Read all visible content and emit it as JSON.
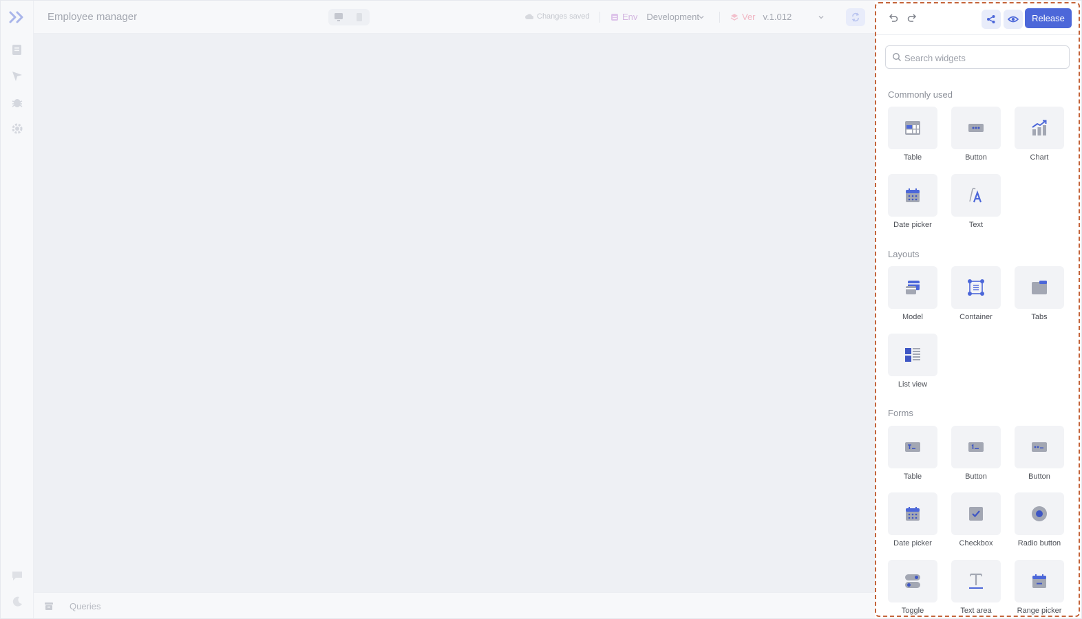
{
  "header": {
    "app_title": "Employee manager",
    "saved_status": "Changes saved",
    "env_label": "Env",
    "env_value": "Development",
    "ver_label": "Ver",
    "ver_value": "v.1.012"
  },
  "queries": {
    "label": "Queries"
  },
  "panel": {
    "release_label": "Release",
    "search_placeholder": "Search widgets",
    "sections": {
      "common": "Commonly  used",
      "layouts": "Layouts",
      "forms": "Forms"
    },
    "common_items": [
      "Table",
      "Button",
      "Chart",
      "Date picker",
      "Text"
    ],
    "layout_items": [
      "Model",
      "Container",
      "Tabs",
      "List view"
    ],
    "form_items": [
      "Table",
      "Button",
      "Button",
      "Date picker",
      "Checkbox",
      "Radio button",
      "Toggle",
      "Text area",
      "Range picker"
    ]
  },
  "colors": {
    "accent": "#4c67d9",
    "icon_gray": "#a3a7b3",
    "panel_border": "#c4643a"
  }
}
